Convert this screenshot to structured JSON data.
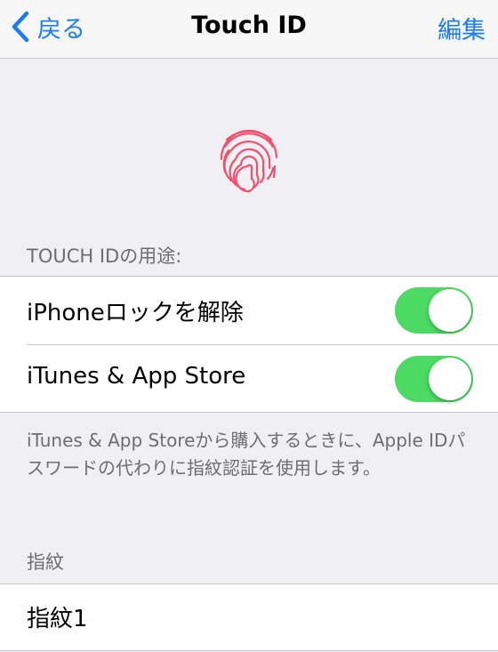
{
  "nav": {
    "back_label": "戻る",
    "title": "Touch ID",
    "edit_label": "編集"
  },
  "usage_header": "TOUCH IDの用途:",
  "toggles": [
    {
      "label": "iPhoneロックを解除",
      "on": true
    },
    {
      "label": "iTunes & App Store",
      "on": true
    }
  ],
  "footer_text": "iTunes & App Storeから購入するときに、Apple IDパスワードの代わりに指紋認証を使用します。",
  "fingerprints_header": "指紋",
  "fingerprints": [
    {
      "label": "指紋1"
    }
  ],
  "colors": {
    "accent": "#1a7cf5",
    "toggle_on": "#4cd964",
    "fingerprint": "#f0506e",
    "background": "#efeff4"
  },
  "icons": [
    "chevron-left-icon",
    "fingerprint-icon"
  ]
}
